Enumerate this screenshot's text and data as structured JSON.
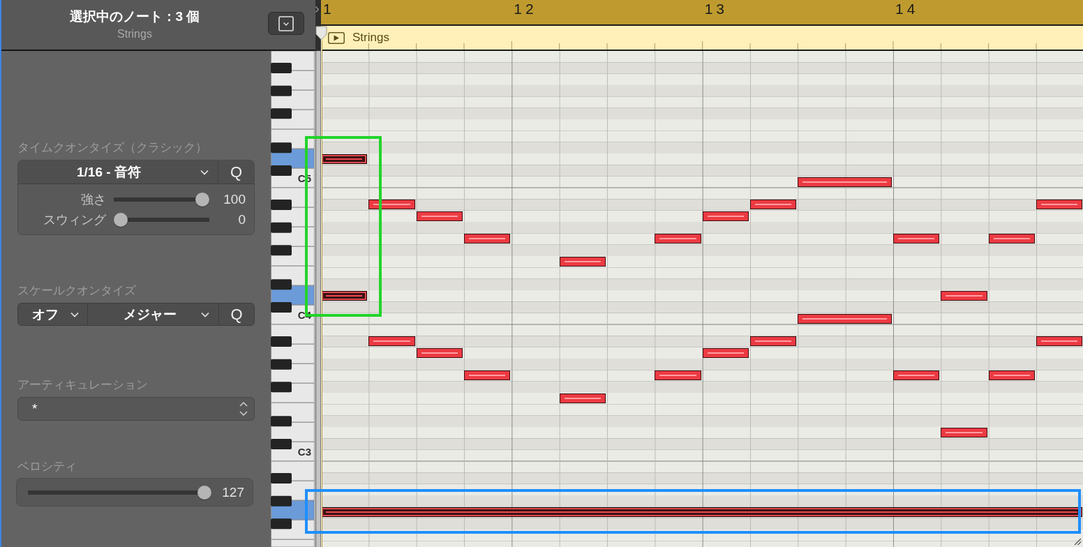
{
  "inspector": {
    "title": "選択中のノート：3 個",
    "subtitle": "Strings"
  },
  "time_quantize": {
    "label": "タイムクオンタイズ（クラシック）",
    "value": "1/16 - 音符",
    "apply": "Q",
    "sliders": [
      {
        "label": "強さ",
        "level": 1,
        "reading": "100"
      },
      {
        "label": "スウィング",
        "level": 0,
        "reading": "0"
      }
    ]
  },
  "scale_quantize": {
    "label": "スケールクオンタイズ",
    "root": "オフ",
    "scale": "メジャー",
    "apply": "Q"
  },
  "articulation": {
    "label": "アーティキュレーション",
    "value": "*"
  },
  "velocity": {
    "label": "ベロシティ",
    "level": 1,
    "reading": "127"
  },
  "ruler": {
    "bars": [
      "1",
      "12",
      "13",
      "14"
    ]
  },
  "region": {
    "name": "Strings"
  },
  "keyboard": {
    "octave_labels": [
      "C5",
      "C4",
      "C3"
    ]
  },
  "notes": [
    {
      "selected": true
    },
    {
      "selected": true
    },
    {
      "selected": true
    },
    {
      "selected": false
    },
    {
      "selected": false
    },
    {
      "selected": false
    },
    {
      "selected": false
    },
    {
      "selected": false
    },
    {
      "selected": false
    },
    {
      "selected": false
    },
    {
      "selected": false
    },
    {
      "selected": false
    },
    {
      "selected": false
    },
    {
      "selected": false
    },
    {
      "selected": false
    },
    {
      "selected": false
    },
    {
      "selected": false
    },
    {
      "selected": false
    },
    {
      "selected": false
    },
    {
      "selected": false
    },
    {
      "selected": false
    },
    {
      "selected": false
    },
    {
      "selected": false
    },
    {
      "selected": false
    },
    {
      "selected": false
    },
    {
      "selected": false
    },
    {
      "selected": false
    }
  ],
  "annotations": [
    {
      "color": "#22d42a"
    },
    {
      "color": "#1f8fff"
    }
  ]
}
